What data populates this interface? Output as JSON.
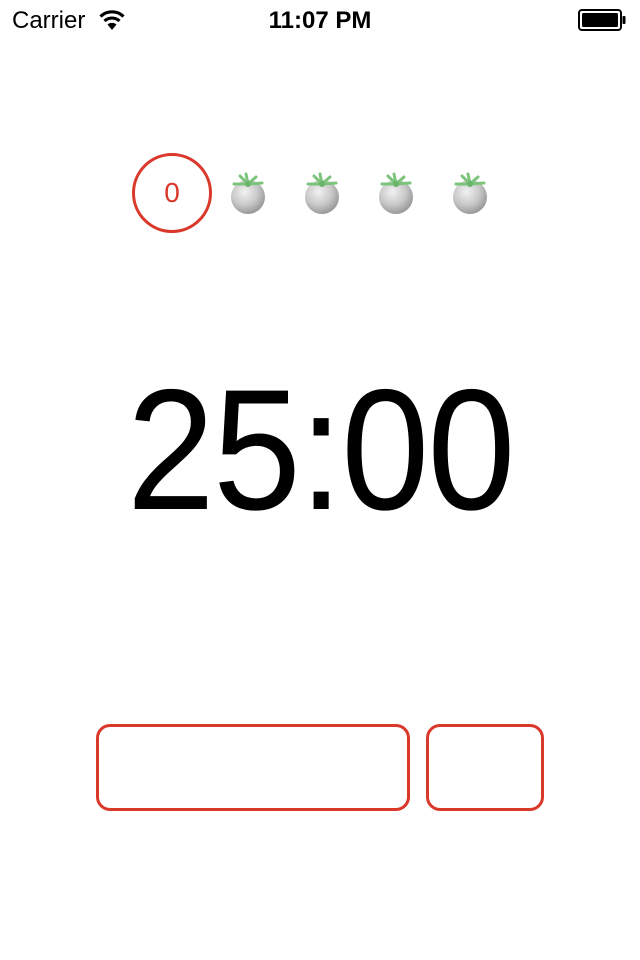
{
  "status_bar": {
    "carrier": "Carrier",
    "time": "11:07 PM",
    "icons": [
      "wifi-icon",
      "battery-icon"
    ]
  },
  "pomodoro": {
    "completed_count": "0",
    "accent_color": "#d9382a",
    "remaining_tomatoes": 4,
    "tomato_icon": "tomato-icon"
  },
  "timer": {
    "display": "25:00"
  },
  "buttons": {
    "start_label": "",
    "reset_label": ""
  }
}
